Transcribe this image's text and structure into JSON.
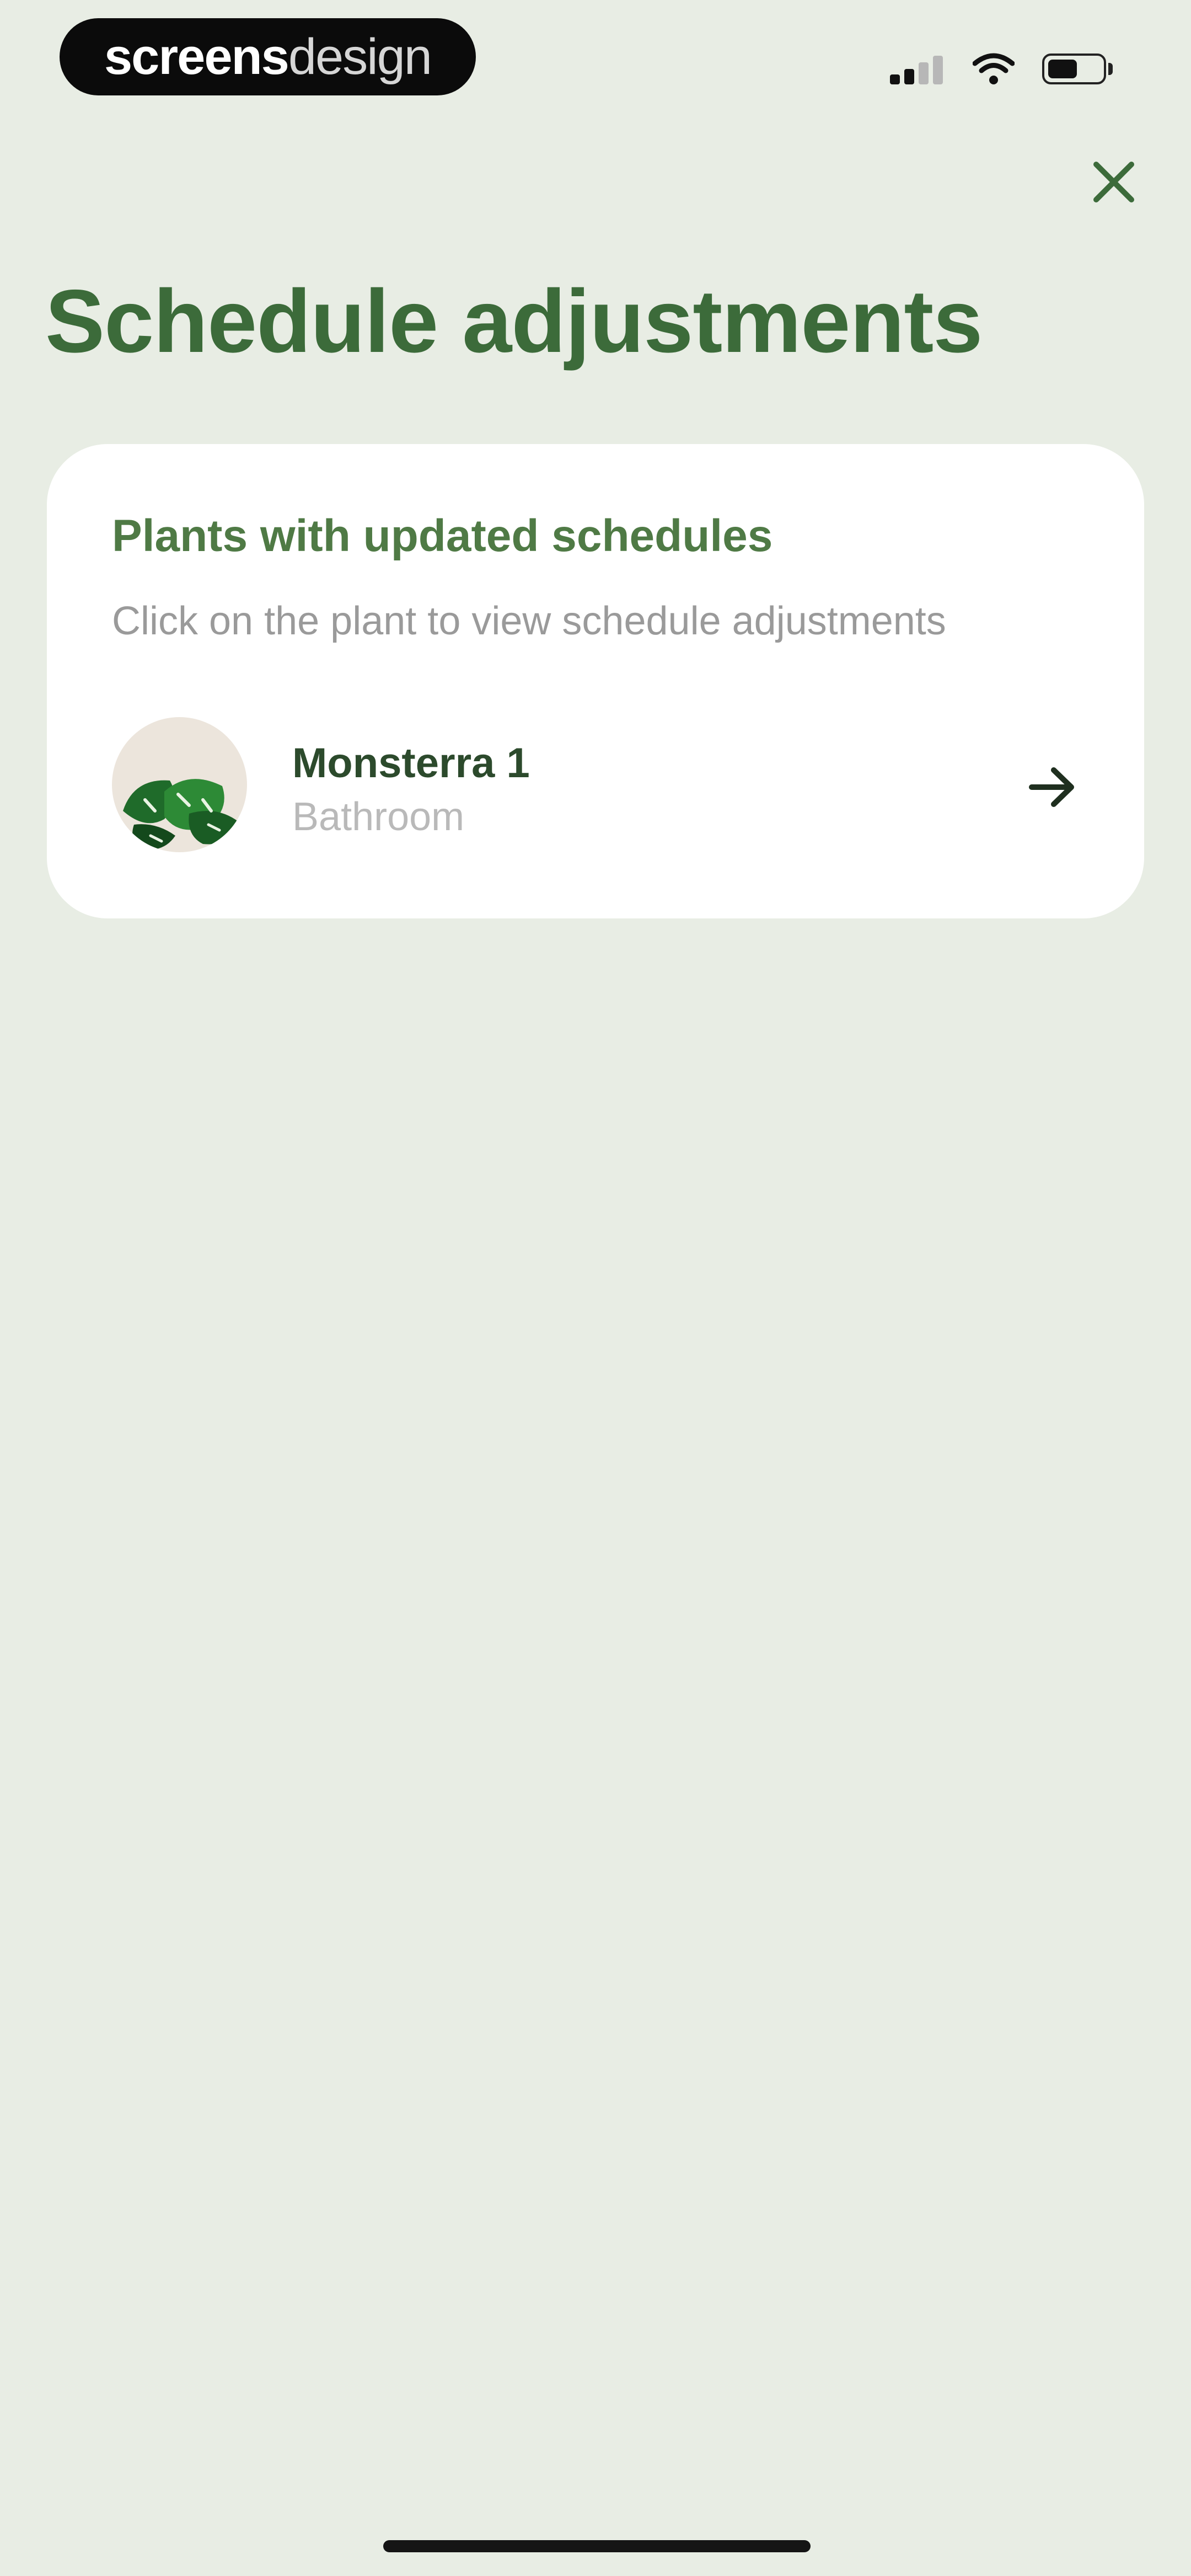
{
  "status_bar": {
    "brand_bold": "screens",
    "brand_light": "design",
    "battery_level": 0.55
  },
  "header": {
    "title": "Schedule adjustments",
    "close_icon": "close-icon"
  },
  "card": {
    "title": "Plants with updated schedules",
    "subtitle": "Click on the plant to view schedule adjustments",
    "plants": [
      {
        "name": "Monsterra 1",
        "room": "Bathroom",
        "icon": "arrow-right-icon"
      }
    ]
  },
  "colors": {
    "background": "#e8ede4",
    "accent": "#3c6b3a",
    "card": "#ffffff"
  }
}
